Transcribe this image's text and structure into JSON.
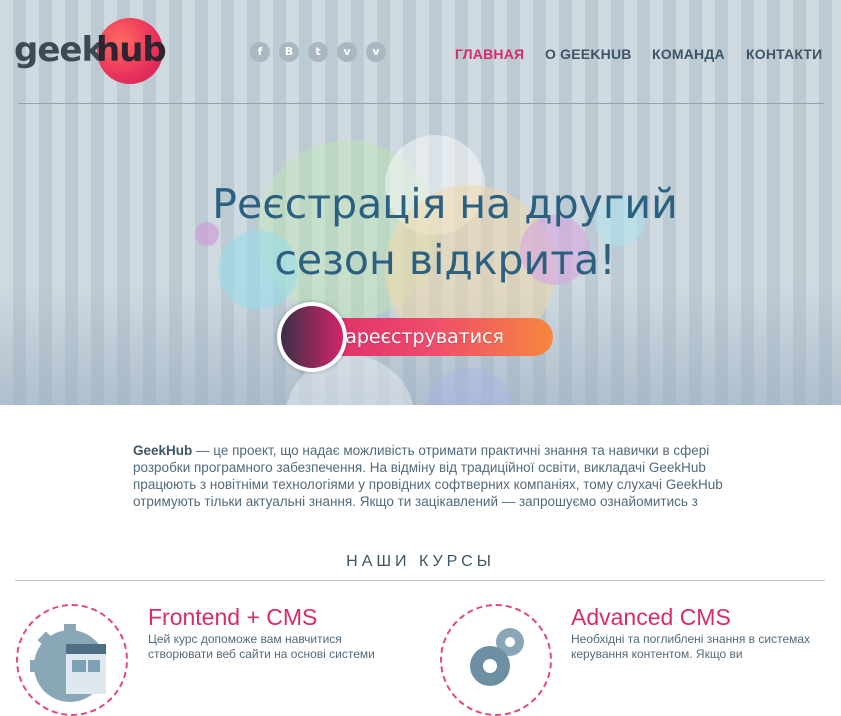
{
  "logo": {
    "part1": "geek",
    "part2": "hub"
  },
  "social": [
    {
      "name": "facebook-icon",
      "glyph": "f"
    },
    {
      "name": "vkontakte-icon",
      "glyph": "B"
    },
    {
      "name": "twitter-icon",
      "glyph": "t"
    },
    {
      "name": "vimeo-square-icon",
      "glyph": "v"
    },
    {
      "name": "vimeo-icon",
      "glyph": "v"
    }
  ],
  "nav": {
    "home": "ГЛАВНАЯ",
    "about": "О GEEKHUB",
    "team": "КОМАНДА",
    "contacts": "КОНТАКТИ"
  },
  "hero": {
    "line1": "Реєстрація на другий",
    "line2": "сезон відкрита!",
    "button": "Зареєструватися"
  },
  "intro": {
    "brand": "GeekHub",
    "text": " — це проект, що надає можливість отримати практичні знання та навички в сфері розробки програмного забезпечення. На відміну від традиційної освіти, викладачі GeekHub працюють з новітніми технологіями у провідних софтверних компаніях, тому слухачі GeekHub отримують тільки актуальні знання. Якщо ти зацікавлений — запрошуємо ознайомитись з"
  },
  "courses": {
    "title": "НАШИ КУРСЫ",
    "items": [
      {
        "title": "Frontend + CMS",
        "desc": "Цей курс допоможе вам навчитися створювати веб сайти на основі системи"
      },
      {
        "title": "Advanced CMS",
        "desc": "Необхідні та поглиблені знання в системах керування контентом. Якщо ви"
      }
    ]
  },
  "colors": {
    "accent": "#d92b69",
    "nav": "#3d5566",
    "headline": "#2c6080"
  }
}
